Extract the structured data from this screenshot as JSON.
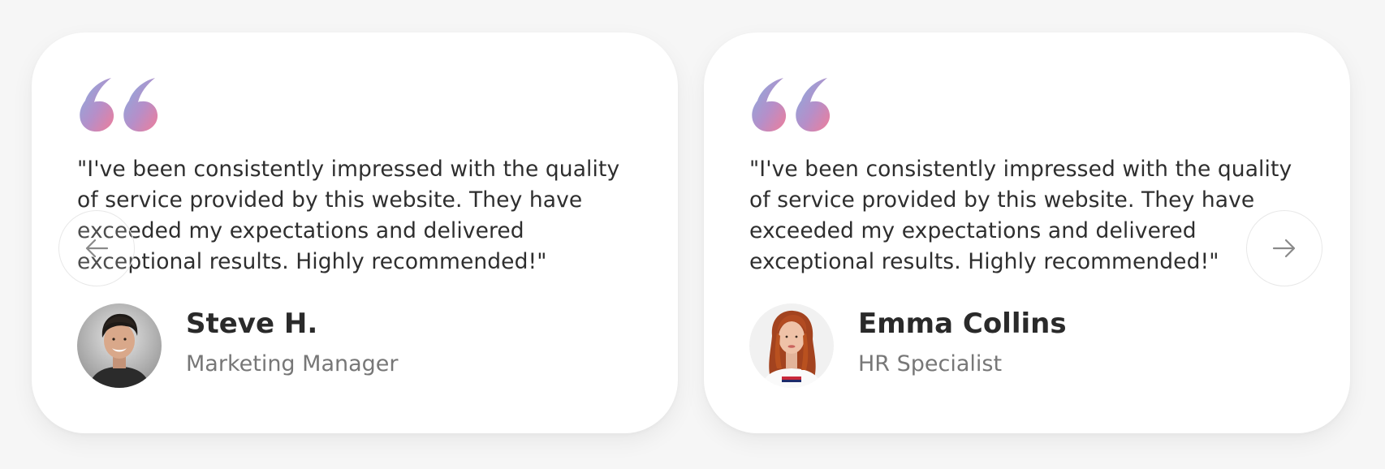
{
  "testimonials": [
    {
      "quote": "\"I've been consistently impressed with the quality of service provided by this website. They have exceeded my expectations and delivered exceptional results. Highly recommended!\"",
      "name": "Steve H.",
      "role": "Marketing Manager",
      "avatar": "man-smiling-avatar"
    },
    {
      "quote": "\"I've been consistently impressed with the quality of service provided by this website. They have exceeded my expectations and delivered exceptional results. Highly recommended!\"",
      "name": "Emma Collins",
      "role": "HR Specialist",
      "avatar": "woman-red-hair-avatar"
    }
  ],
  "navigation": {
    "prev_icon": "arrow-left-icon",
    "next_icon": "arrow-right-icon"
  },
  "colors": {
    "background": "#f6f6f6",
    "card": "#ffffff",
    "quote_gradient_start": "#86aee0",
    "quote_gradient_end": "#ef7d9a",
    "name": "#2a2a2a",
    "role": "#777777"
  }
}
